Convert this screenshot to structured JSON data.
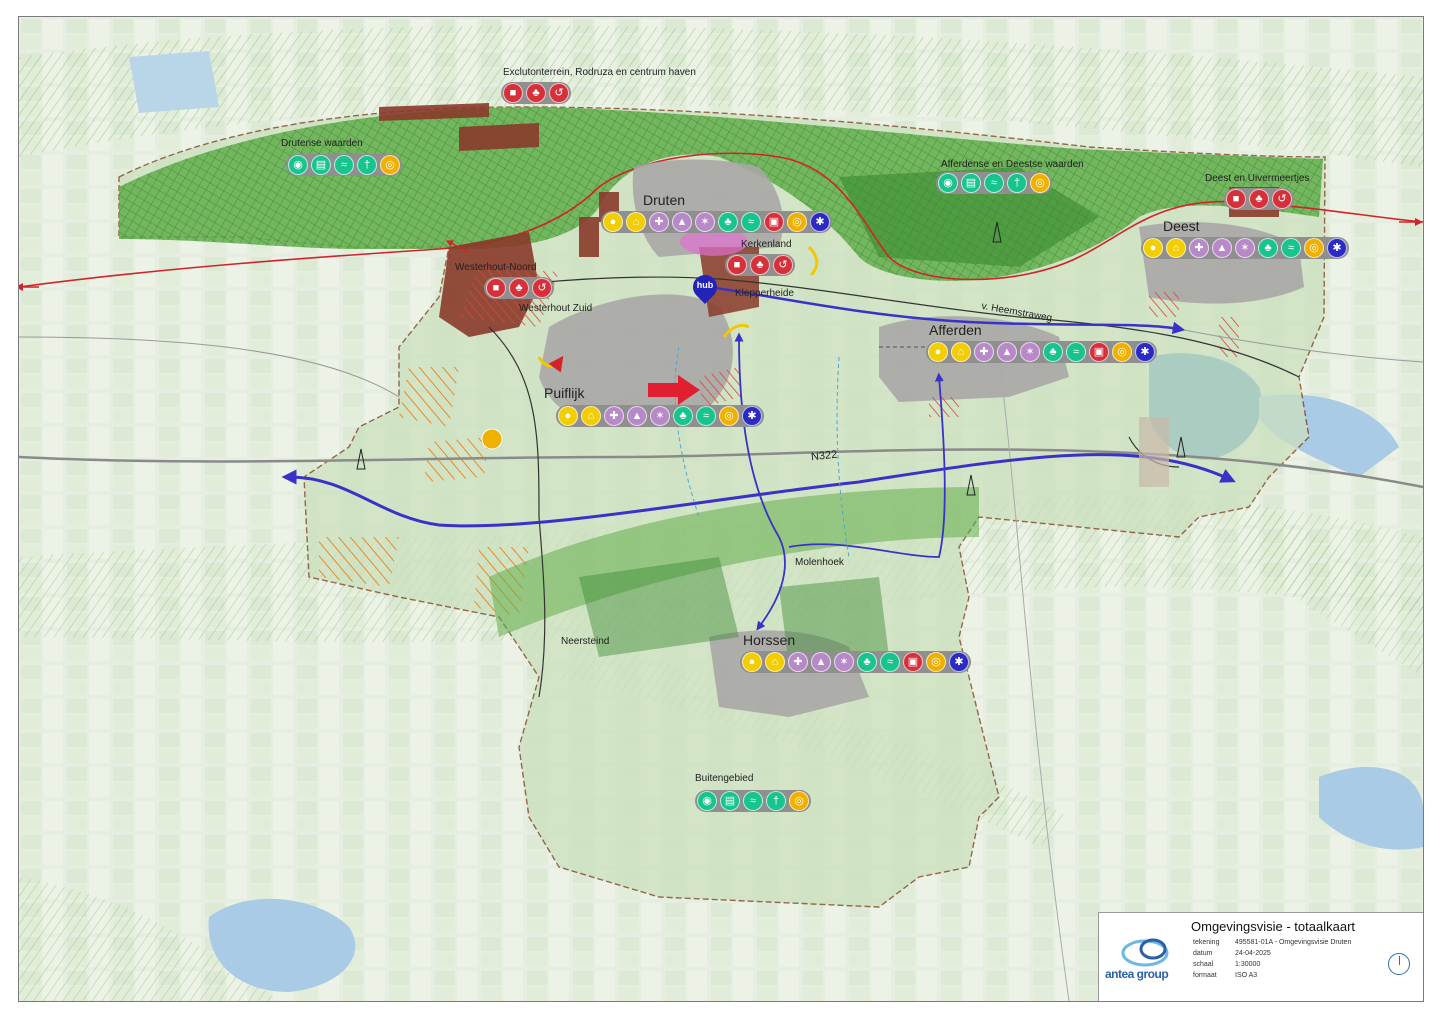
{
  "title_block": {
    "title": "Omgevingsvisie - totaalkaart",
    "rows": [
      {
        "key": "tekening",
        "value": "495581-01A - Omgevingsvisie Druten"
      },
      {
        "key": "datum",
        "value": "24-04-2025"
      },
      {
        "key": "schaal",
        "value": "1:30000"
      },
      {
        "key": "formaat",
        "value": "ISO A3"
      }
    ],
    "logo_text": "antea group"
  },
  "places": {
    "druten": "Druten",
    "deest": "Deest",
    "afferden": "Afferden",
    "puiflijk": "Puiflijk",
    "horssen": "Horssen"
  },
  "areas": {
    "exclutonterrein": "Exclutonterrein, Rodruza en centrum haven",
    "drutense_waarden": "Drutense waarden",
    "afferdense_deestse": "Afferdense en Deestse waarden",
    "deest_uivermeertjes": "Deest en Uivermeertjes",
    "westerhout_noord": "Westerhout-Noord",
    "westerhout_zuid": "Westerhout Zuid",
    "kerkenland": "Kerkenland",
    "klepperheide": "Klepperheide",
    "molenhoek": "Molenhoek",
    "neersteind": "Neersteind",
    "buitengebied": "Buitengebied",
    "n322": "N322",
    "heemstraweg": "v. Heemstraweg"
  },
  "hub_label": "hub",
  "colors": {
    "living": "#f2cd00",
    "social": "#b889c9",
    "green": "#18c48d",
    "economy": "#d6303a",
    "energy": "#f0b000",
    "network": "#2a2ac4",
    "boundary": "#8a3a1a",
    "dike": "#d2232a",
    "route": "#3a32c8"
  },
  "strips": {
    "exclutonterrein": [
      "briefcase-icon:economy",
      "tree-icon:economy",
      "recycle-icon:economy"
    ],
    "drutense_waarden": [
      "eye-icon:green",
      "tractor-icon:green",
      "water-icon:green",
      "walker-icon:green",
      "globe-icon:energy"
    ],
    "druten": [
      "people-icon:living",
      "house-icon:living",
      "care-icon:social",
      "school-icon:social",
      "sport-icon:social",
      "tree-icon:green",
      "water-icon:green",
      "cart-icon:economy",
      "globe-icon:energy",
      "network-icon:network"
    ],
    "afferdense_deestse": [
      "eye-icon:green",
      "tractor-icon:green",
      "water-icon:green",
      "walker-icon:green",
      "globe-icon:energy"
    ],
    "deest_uivermeertjes": [
      "briefcase-icon:economy",
      "tree-icon:economy",
      "recycle-icon:economy"
    ],
    "deest": [
      "people-icon:living",
      "house-icon:living",
      "care-icon:social",
      "school-icon:social",
      "sport-icon:social",
      "tree-icon:green",
      "water-icon:green",
      "globe-icon:energy",
      "network-icon:network"
    ],
    "kerkenland": [
      "briefcase-icon:economy",
      "tree-icon:economy",
      "recycle-icon:economy"
    ],
    "westerhout_noord": [
      "briefcase-icon:economy",
      "tree-icon:economy",
      "recycle-icon:economy"
    ],
    "afferden": [
      "people-icon:living",
      "house-icon:living",
      "care-icon:social",
      "school-icon:social",
      "sport-icon:social",
      "tree-icon:green",
      "water-icon:green",
      "cart-icon:economy",
      "globe-icon:energy",
      "network-icon:network"
    ],
    "puiflijk": [
      "people-icon:living",
      "house-icon:living",
      "care-icon:social",
      "school-icon:social",
      "sport-icon:social",
      "tree-icon:green",
      "water-icon:green",
      "globe-icon:energy",
      "network-icon:network"
    ],
    "horssen": [
      "people-icon:living",
      "house-icon:living",
      "care-icon:social",
      "school-icon:social",
      "sport-icon:social",
      "tree-icon:green",
      "water-icon:green",
      "cart-icon:economy",
      "globe-icon:energy",
      "network-icon:network"
    ],
    "buitengebied": [
      "eye-icon:green",
      "tractor-icon:green",
      "water-icon:green",
      "walker-icon:green",
      "globe-icon:energy"
    ]
  }
}
